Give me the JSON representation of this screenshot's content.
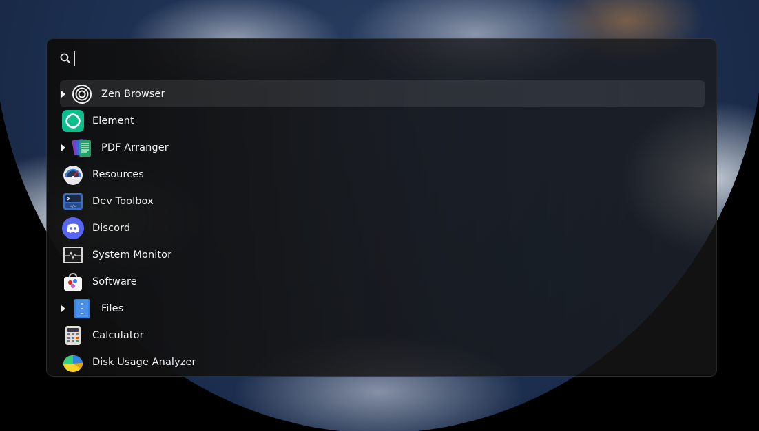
{
  "search": {
    "value": "",
    "placeholder": ""
  },
  "results": [
    {
      "label": "Zen Browser",
      "icon": "zen-browser-icon",
      "expandable": true,
      "selected": true
    },
    {
      "label": "Element",
      "icon": "element-icon",
      "expandable": false,
      "selected": false
    },
    {
      "label": "PDF Arranger",
      "icon": "pdf-arranger-icon",
      "expandable": true,
      "selected": false
    },
    {
      "label": "Resources",
      "icon": "resources-icon",
      "expandable": false,
      "selected": false
    },
    {
      "label": "Dev Toolbox",
      "icon": "dev-toolbox-icon",
      "expandable": false,
      "selected": false
    },
    {
      "label": "Discord",
      "icon": "discord-icon",
      "expandable": false,
      "selected": false
    },
    {
      "label": "System Monitor",
      "icon": "system-monitor-icon",
      "expandable": false,
      "selected": false
    },
    {
      "label": "Software",
      "icon": "software-icon",
      "expandable": false,
      "selected": false
    },
    {
      "label": "Files",
      "icon": "files-icon",
      "expandable": true,
      "selected": false
    },
    {
      "label": "Calculator",
      "icon": "calculator-icon",
      "expandable": false,
      "selected": false
    },
    {
      "label": "Disk Usage Analyzer",
      "icon": "disk-usage-analyzer-icon",
      "expandable": false,
      "selected": false
    }
  ],
  "colors": {
    "element": "#0dbd8b",
    "discord": "#5865f2",
    "files": "#3584e4"
  }
}
